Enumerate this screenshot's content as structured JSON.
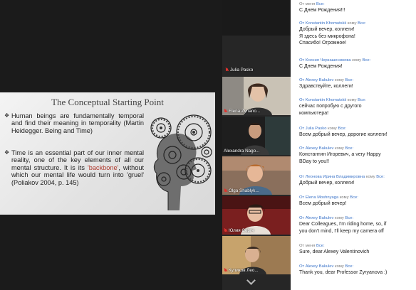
{
  "colors": {
    "chat_link": "#3a73c8",
    "active_speaker": "#c6d93c",
    "slide_accent": "#b03a2e",
    "mic_muted": "#e0332f"
  },
  "slide": {
    "title": "The Conceptual Starting Point",
    "bullets": [
      {
        "mark": "❖",
        "text": "Human beings are fundamentally temporal and find their meaning in temporality (Martin Heidegger. Being and Time)"
      },
      {
        "mark": "❖",
        "text_before": "Time is an essential part of our inner mental reality, one of the key elements of all our mental structure. It is its ",
        "keyword": "'backbone'",
        "text_after": ", without which our mental life would turn into 'gruel' (Poliakov 2004, p. 145)"
      }
    ],
    "illustration_icon": "gear-head-illustration"
  },
  "participants": [
    {
      "name": "Julia Pasko",
      "muted": true,
      "video": false
    },
    {
      "name": "Elena Zyriano...",
      "muted": true,
      "video": true
    },
    {
      "name": "Alexandra Nago...",
      "muted": false,
      "video": true,
      "active": true
    },
    {
      "name": "Olga Shablyk...",
      "muted": true,
      "video": true
    },
    {
      "name": "Юлия Сергч",
      "muted": true,
      "video": true
    },
    {
      "name": "Куликов Лео...",
      "muted": true,
      "video": true
    }
  ],
  "strip_toggle_icon": "chevron-down-icon",
  "chat": {
    "messages": [
      {
        "from": "От меня",
        "to": "Все:",
        "lines": [
          "С Днем Рождения!!!"
        ]
      },
      {
        "from": "От Konstantin Khomutskii",
        "to_prefix": "кому",
        "to": "Все:",
        "lines": [
          "Добрый вечер, коллеги!",
          "Я здесь без микрофона!",
          "Спасибо! Огромное!"
        ]
      },
      {
        "from": "От Ксения Черкашенинова",
        "to_prefix": "кому",
        "to": "Все:",
        "lines": [
          "С Днем Рождения!"
        ]
      },
      {
        "from": "От Alexey Bakulev",
        "to_prefix": "кому",
        "to": "Все:",
        "lines": [
          "Здравствуйте, коллеги!"
        ]
      },
      {
        "from": "От Konstantin Khomutskii",
        "to_prefix": "кому",
        "to": "Все:",
        "lines": [
          "сейчас попробую с другого",
          "компьютера!"
        ]
      },
      {
        "from": "От Julia Pasko",
        "to_prefix": "кому",
        "to": "Все:",
        "lines": [
          "Всем добрый вечер, дорогие коллеги!"
        ]
      },
      {
        "from": "От Alexey Bakulev",
        "to_prefix": "кому",
        "to": "Все:",
        "lines": [
          "Константин Игоревич, a very Happy",
          "BDay to you!!"
        ]
      },
      {
        "from": "От Леонова Ирина Владимировна",
        "to_prefix": "кому",
        "to": "Все:",
        "lines": [
          "Добрый вечер, коллеги!"
        ]
      },
      {
        "from": "От Elena Moshnyaga",
        "to_prefix": "кому",
        "to": "Все:",
        "lines": [
          "Всем добрый вечер!"
        ]
      },
      {
        "from": "От Alexey Bakulev",
        "to_prefix": "кому",
        "to": "Все:",
        "lines": [
          "Dear Colleagues, I'm riding home, so, if",
          "you don't mind, I'll keep my camera off"
        ]
      },
      {
        "from": "От меня",
        "to": "Все:",
        "lines": [
          "Sure, dear Alexey Valentinovich"
        ]
      },
      {
        "from": "От Alexey Bakulev",
        "to_prefix": "кому",
        "to": "Все:",
        "lines": [
          "Thank you, dear Professor Zyryanova :)"
        ]
      }
    ]
  }
}
